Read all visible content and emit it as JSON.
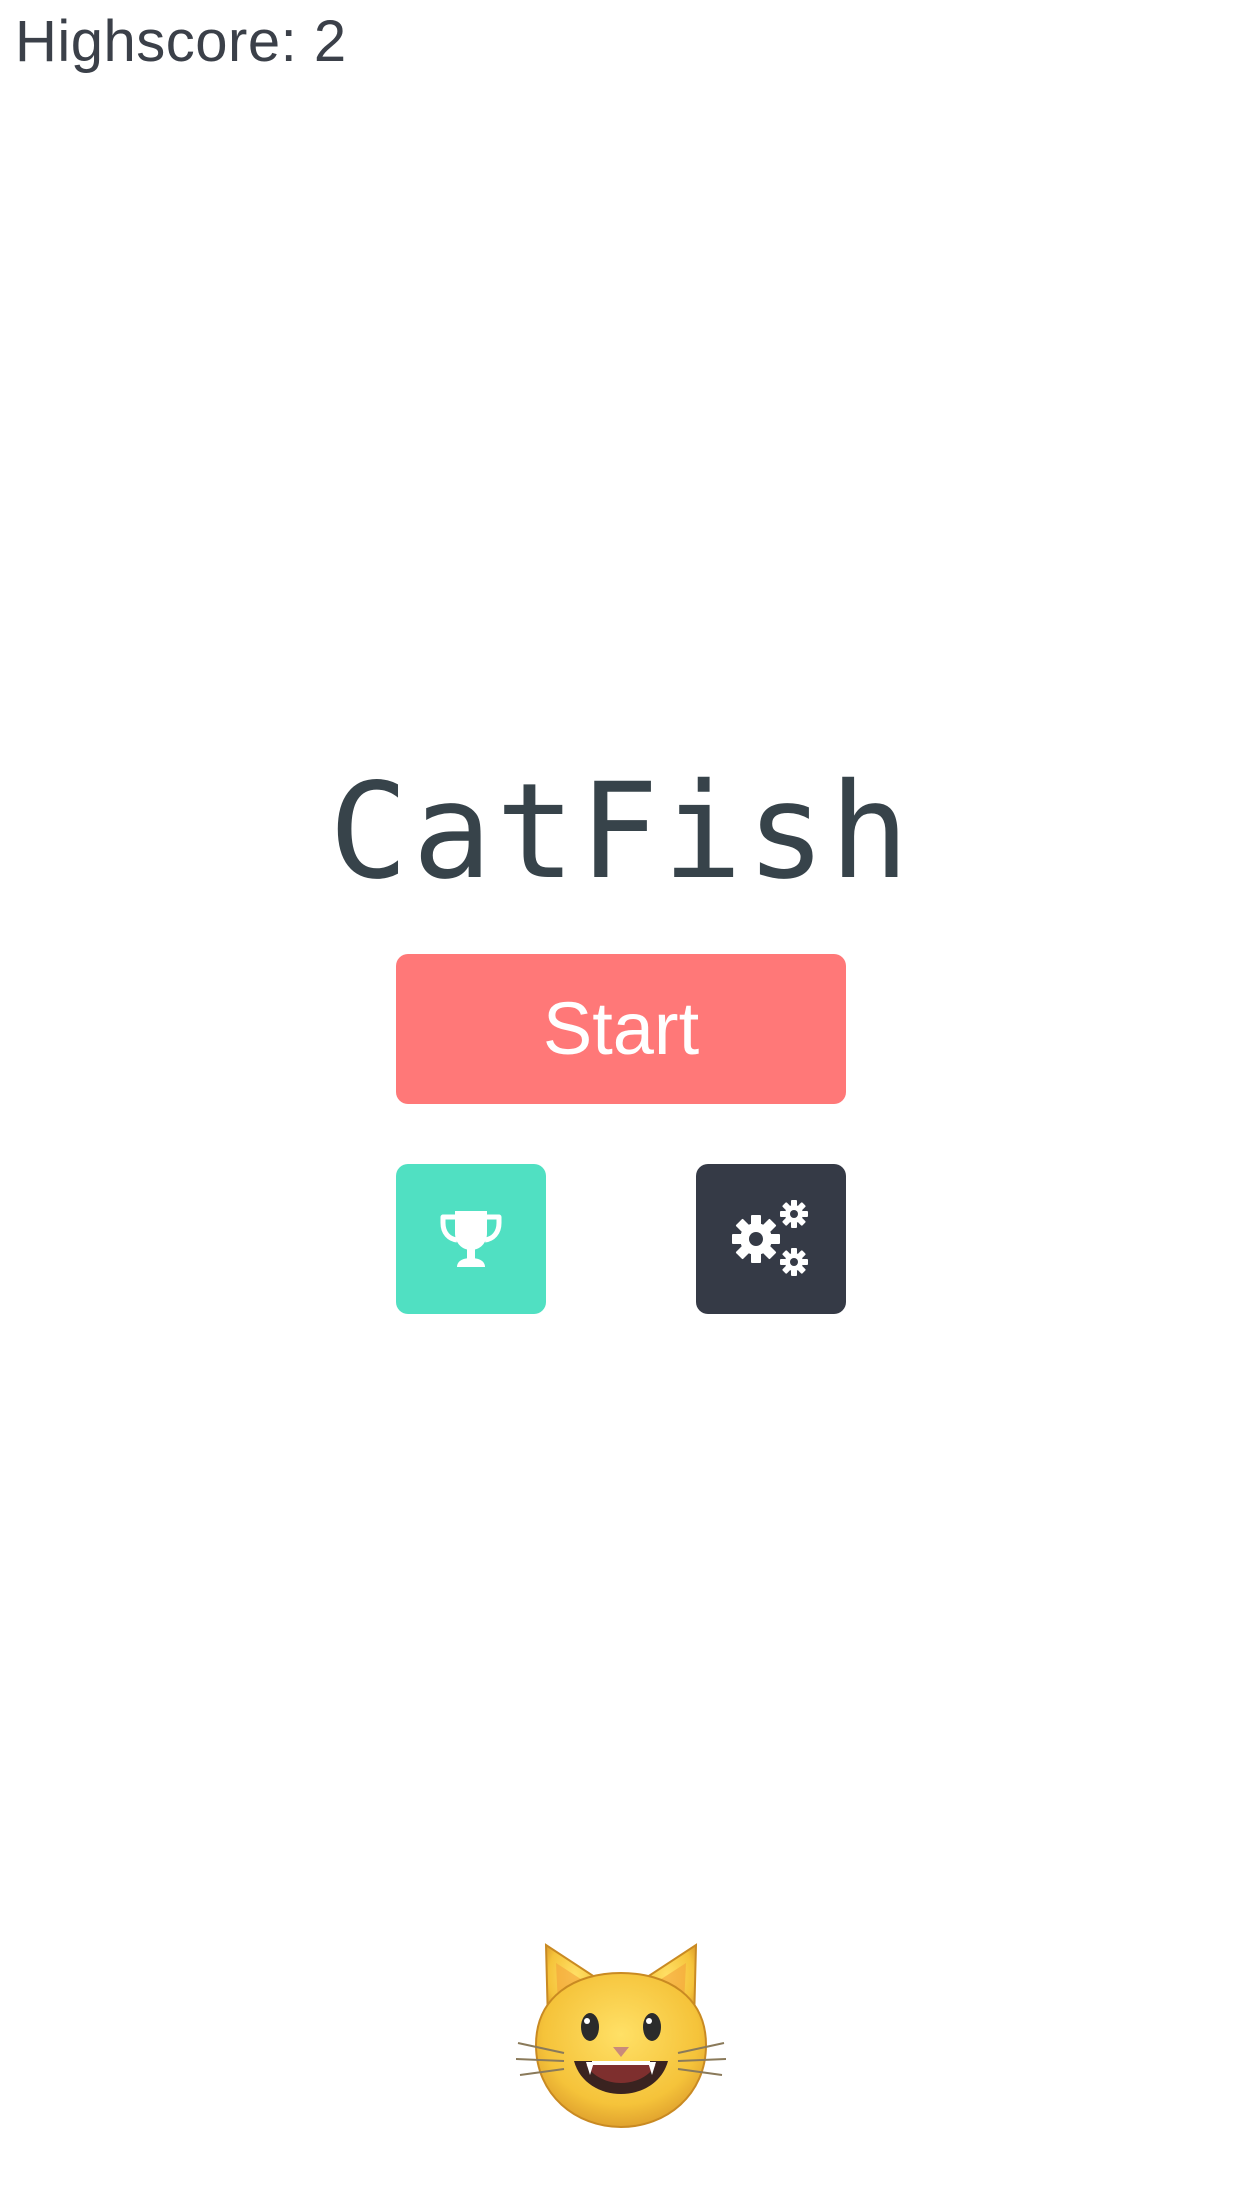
{
  "hud": {
    "highscore_label": "Highscore: 2"
  },
  "menu": {
    "title": "CatFish",
    "start_label": "Start",
    "leaderboard_icon": "trophy-icon",
    "settings_icon": "gears-icon"
  },
  "character": {
    "icon": "grinning-cat-icon"
  },
  "colors": {
    "background": "#ffffff",
    "text": "#3b4049",
    "title": "#37434a",
    "start": "#ff7878",
    "leaderboard": "#50e0c2",
    "settings": "#353a46",
    "cat_face": "#f5c33a"
  }
}
